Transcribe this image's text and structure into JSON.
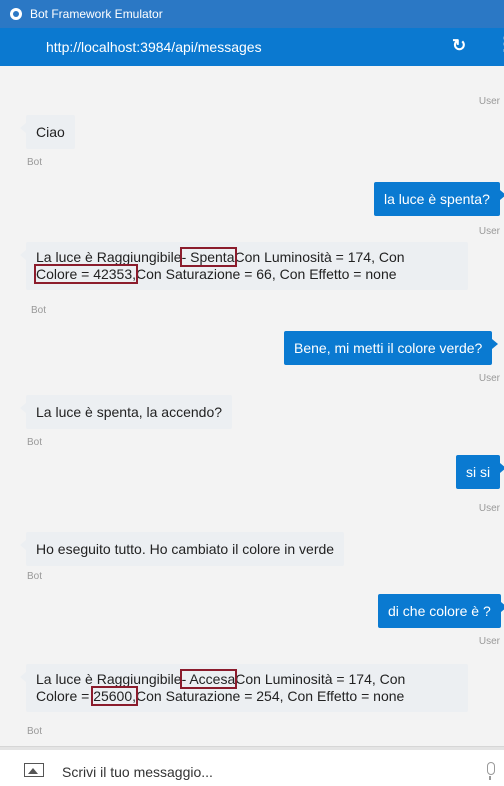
{
  "window": {
    "title": "Bot Framework Emulator"
  },
  "address": {
    "url": "http://localhost:3984/api/messages"
  },
  "icons": {
    "app": "bot-emulator-icon",
    "refresh": "refresh-icon",
    "more": "more-vertical-icon",
    "image": "image-upload-icon",
    "mic": "microphone-icon"
  },
  "colors": {
    "titlebar": "#2b78c5",
    "addressbar": "#0b79d0",
    "user_bubble": "#0a7ad1",
    "bot_bubble": "#eceff2",
    "highlight": "#8b1c2c"
  },
  "labels": {
    "user": "User",
    "bot": "Bot"
  },
  "messages": {
    "m1": {
      "text": "Ciao"
    },
    "m2": {
      "text": "la luce è spenta?"
    },
    "m3": {
      "a": "La luce è Raggiungibile",
      "b": "- Spenta",
      "c": "Con Luminosità = 174, Con",
      "d": "Colore = 42353,",
      "e": "Con Saturazione = 66, Con Effetto = none"
    },
    "m4": {
      "text": "Bene, mi metti il colore verde?"
    },
    "m5": {
      "text": "La luce è spenta, la accendo?"
    },
    "m6": {
      "text": "si si"
    },
    "m7": {
      "text": "Ho eseguito tutto. Ho cambiato il colore in verde"
    },
    "m8": {
      "text": "di che colore è ?"
    },
    "m9": {
      "a": "La luce è Raggiungibile",
      "b": "- Accesa",
      "c": "Con Luminosità = 174, Con",
      "d1": "Colore = ",
      "d2": "25600,",
      "e": "Con Saturazione = 254, Con Effetto = none"
    }
  },
  "input": {
    "placeholder": "Scrivi il tuo messaggio..."
  }
}
